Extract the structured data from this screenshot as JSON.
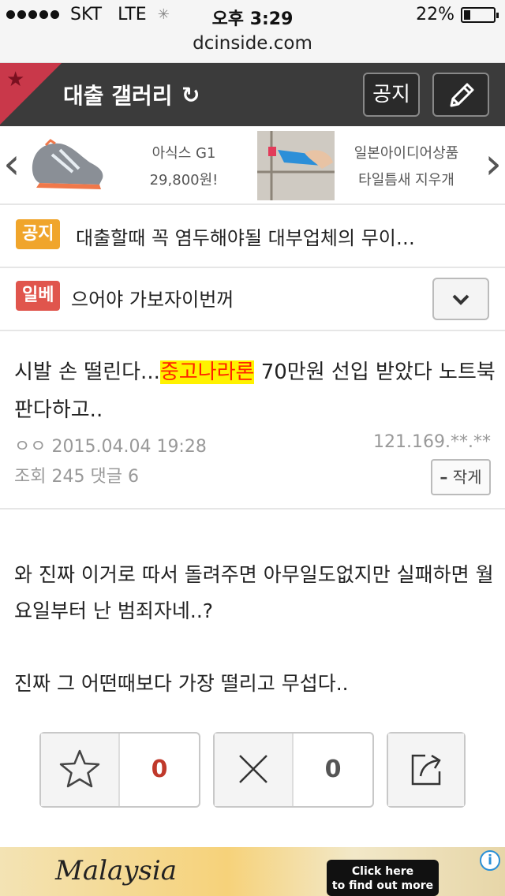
{
  "status_bar": {
    "carrier": "SKT",
    "network": "LTE",
    "time": "오후 3:29",
    "battery_percent_text": "22%",
    "battery_level": 0.22,
    "url": "dcinside.com"
  },
  "header": {
    "title": "대출 갤러리",
    "notice_label": "공지"
  },
  "ads": [
    {
      "title": "아식스 G1",
      "subtitle": "29,800원!"
    },
    {
      "title": "일본아이디어상품",
      "subtitle": "타일틈새 지우개"
    }
  ],
  "notices": [
    {
      "tag": "공지",
      "text": "대출할때 꼭 염두해야될 대부업체의 무이…"
    },
    {
      "tag": "일베",
      "text": "으어야 가보자이번꺼"
    }
  ],
  "post": {
    "title_before": "시발 손 떨린다...",
    "title_highlight": "중고나라론",
    "title_after": " 70만원 선입 받았다 노트북 판다하고..",
    "author": "ㅇㅇ",
    "date": "2015.04.04 19:28",
    "ip": "121.169.**.**",
    "views_label": "조회",
    "views": "245",
    "comments_label": "댓글",
    "comments": "6",
    "report_label": "작게",
    "body_line1": "와 진짜 이거로 따서 돌려주면 아무일도없지만 실패하면 월요일부터 난 범죄자네..?",
    "body_line2": "진짜 그 어떤때보다 가장 떨리고 무섭다.."
  },
  "votes": {
    "up_count": "0",
    "down_count": "0"
  },
  "banner": {
    "logo": "Malaysia",
    "cta_line1": "Click here",
    "cta_line2": "to find out more"
  },
  "colors": {
    "header_bg": "#3b3b3b",
    "corner_red": "#c9384a",
    "notice_tag": "#f0a52b",
    "ilbe_tag": "#e0554d",
    "highlight_bg": "#fff200",
    "highlight_text": "#ff2200",
    "vote_up_count": "#c0392b"
  },
  "icons": {
    "corner": "star-icon",
    "refresh": "refresh-icon",
    "write": "pencil-icon",
    "dropdown": "chevron-down-icon",
    "recommend": "star-outline-icon",
    "not_recommend": "x-icon",
    "share": "share-icon",
    "info": "info-icon"
  }
}
